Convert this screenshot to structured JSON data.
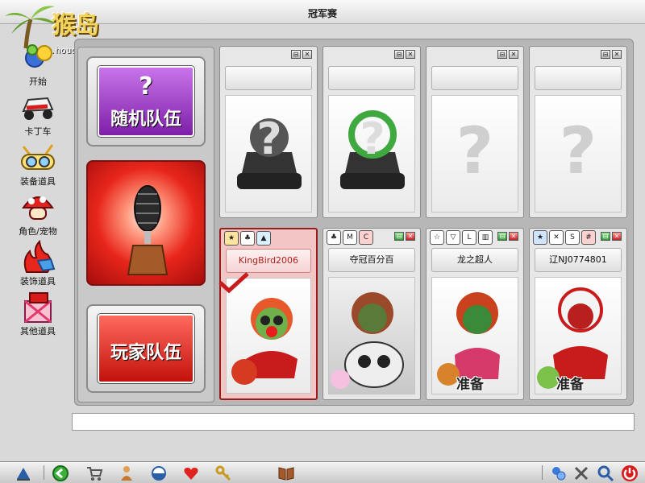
{
  "window": {
    "title": "冠军赛"
  },
  "logo": {
    "brand": "猴岛",
    "url": "bbs.houdao.com"
  },
  "sidebar": {
    "items": [
      {
        "label": "开始",
        "icon": "start-icon"
      },
      {
        "label": "卡丁车",
        "icon": "kart-icon"
      },
      {
        "label": "装备道具",
        "icon": "goggles-icon"
      },
      {
        "label": "角色/宠物",
        "icon": "mushroom-icon"
      },
      {
        "label": "装饰道具",
        "icon": "flame-shirt-icon"
      },
      {
        "label": "其他道具",
        "icon": "giftbox-icon"
      }
    ]
  },
  "left_panel": {
    "random_team": {
      "q": "?",
      "label": "随机队伍"
    },
    "player_team": {
      "label": "玩家队伍"
    },
    "trophy_icon": "trophy-icon"
  },
  "top_slots": [
    {
      "state": "kart-unknown",
      "placeholder": ""
    },
    {
      "state": "kart-unknown",
      "placeholder": ""
    },
    {
      "state": "empty",
      "placeholder": "?"
    },
    {
      "state": "empty",
      "placeholder": "?"
    }
  ],
  "players": [
    {
      "name": "KingBird2006",
      "status": "",
      "selected": true
    },
    {
      "name": "夺冠百分百",
      "status": ""
    },
    {
      "name": "龙之超人",
      "status": "准备"
    },
    {
      "name": "辽NJ0774801",
      "status": "准备"
    }
  ],
  "slot_controls": {
    "slider": "⊟",
    "close": "✕"
  },
  "colors": {
    "accent_red": "#e8261b",
    "accent_purple": "#8e2bb5",
    "selected_border": "#9a1d1d"
  },
  "taskbar": {
    "left_icons": [
      "windows-icon",
      "back-icon",
      "shop-cart-icon",
      "character-icon",
      "capsule-icon",
      "heart-icon",
      "key-icon",
      "book-icon"
    ],
    "right_icons": [
      "network-icon",
      "tools-icon",
      "magnifier-icon",
      "power-icon"
    ]
  }
}
